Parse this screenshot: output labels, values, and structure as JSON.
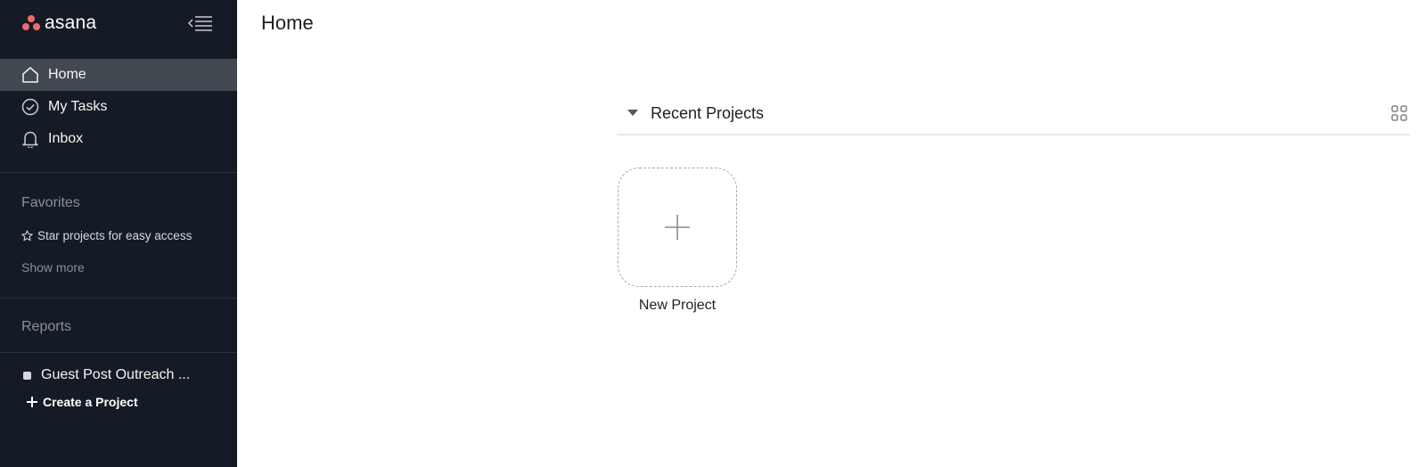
{
  "brand": {
    "logo_text": "asana",
    "logo_color": "#f06a6a"
  },
  "sidebar": {
    "background": "#151b26",
    "nav": [
      {
        "label": "Home",
        "icon": "home-icon",
        "active": true
      },
      {
        "label": "My Tasks",
        "icon": "check-circle-icon",
        "active": false
      },
      {
        "label": "Inbox",
        "icon": "bell-icon",
        "active": false
      }
    ],
    "favorites": {
      "title": "Favorites",
      "hint": "Star projects for easy access",
      "show_more": "Show more"
    },
    "reports": {
      "title": "Reports"
    },
    "projects": [
      {
        "label": "Guest Post Outreach ..."
      }
    ],
    "create_project_label": "Create a Project"
  },
  "main": {
    "page_title": "Home",
    "recent_projects": {
      "title": "Recent Projects",
      "tiles": [
        {
          "label": "New Project",
          "icon": "plus-icon"
        }
      ]
    }
  }
}
